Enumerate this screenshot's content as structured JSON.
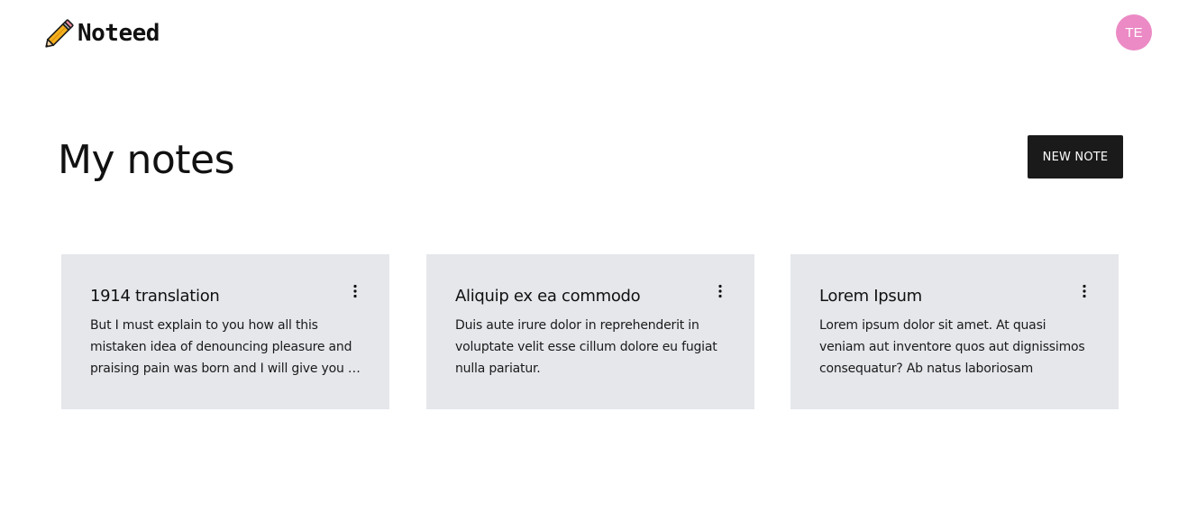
{
  "app": {
    "logo_text": "Noteed",
    "logo_icon": "pencil-icon"
  },
  "user": {
    "initials": "TE",
    "avatar_color": "#ec8ac5"
  },
  "main": {
    "title": "My notes",
    "new_note_label": "NEW NOTE",
    "new_note_color": "#1a1a1a"
  },
  "notes": [
    {
      "title": "1914 translation",
      "body": "But I must explain to you how all this mistaken idea of denouncing pleasure and praising pain was born and I will give you a complete account of the system",
      "menu_icon": "more-vertical-icon"
    },
    {
      "title": "Aliquip ex ea commodo",
      "body": "Duis aute irure dolor in reprehenderit in voluptate velit esse cillum dolore eu fugiat nulla pariatur.",
      "menu_icon": "more-vertical-icon"
    },
    {
      "title": "Lorem Ipsum",
      "body": "Lorem ipsum dolor sit amet. At quasi veniam aut inventore quos aut dignissimos consequatur? Ab natus laboriosam",
      "menu_icon": "more-vertical-icon"
    }
  ],
  "colors": {
    "card_background": "#e5e7eb",
    "text": "#111111"
  }
}
